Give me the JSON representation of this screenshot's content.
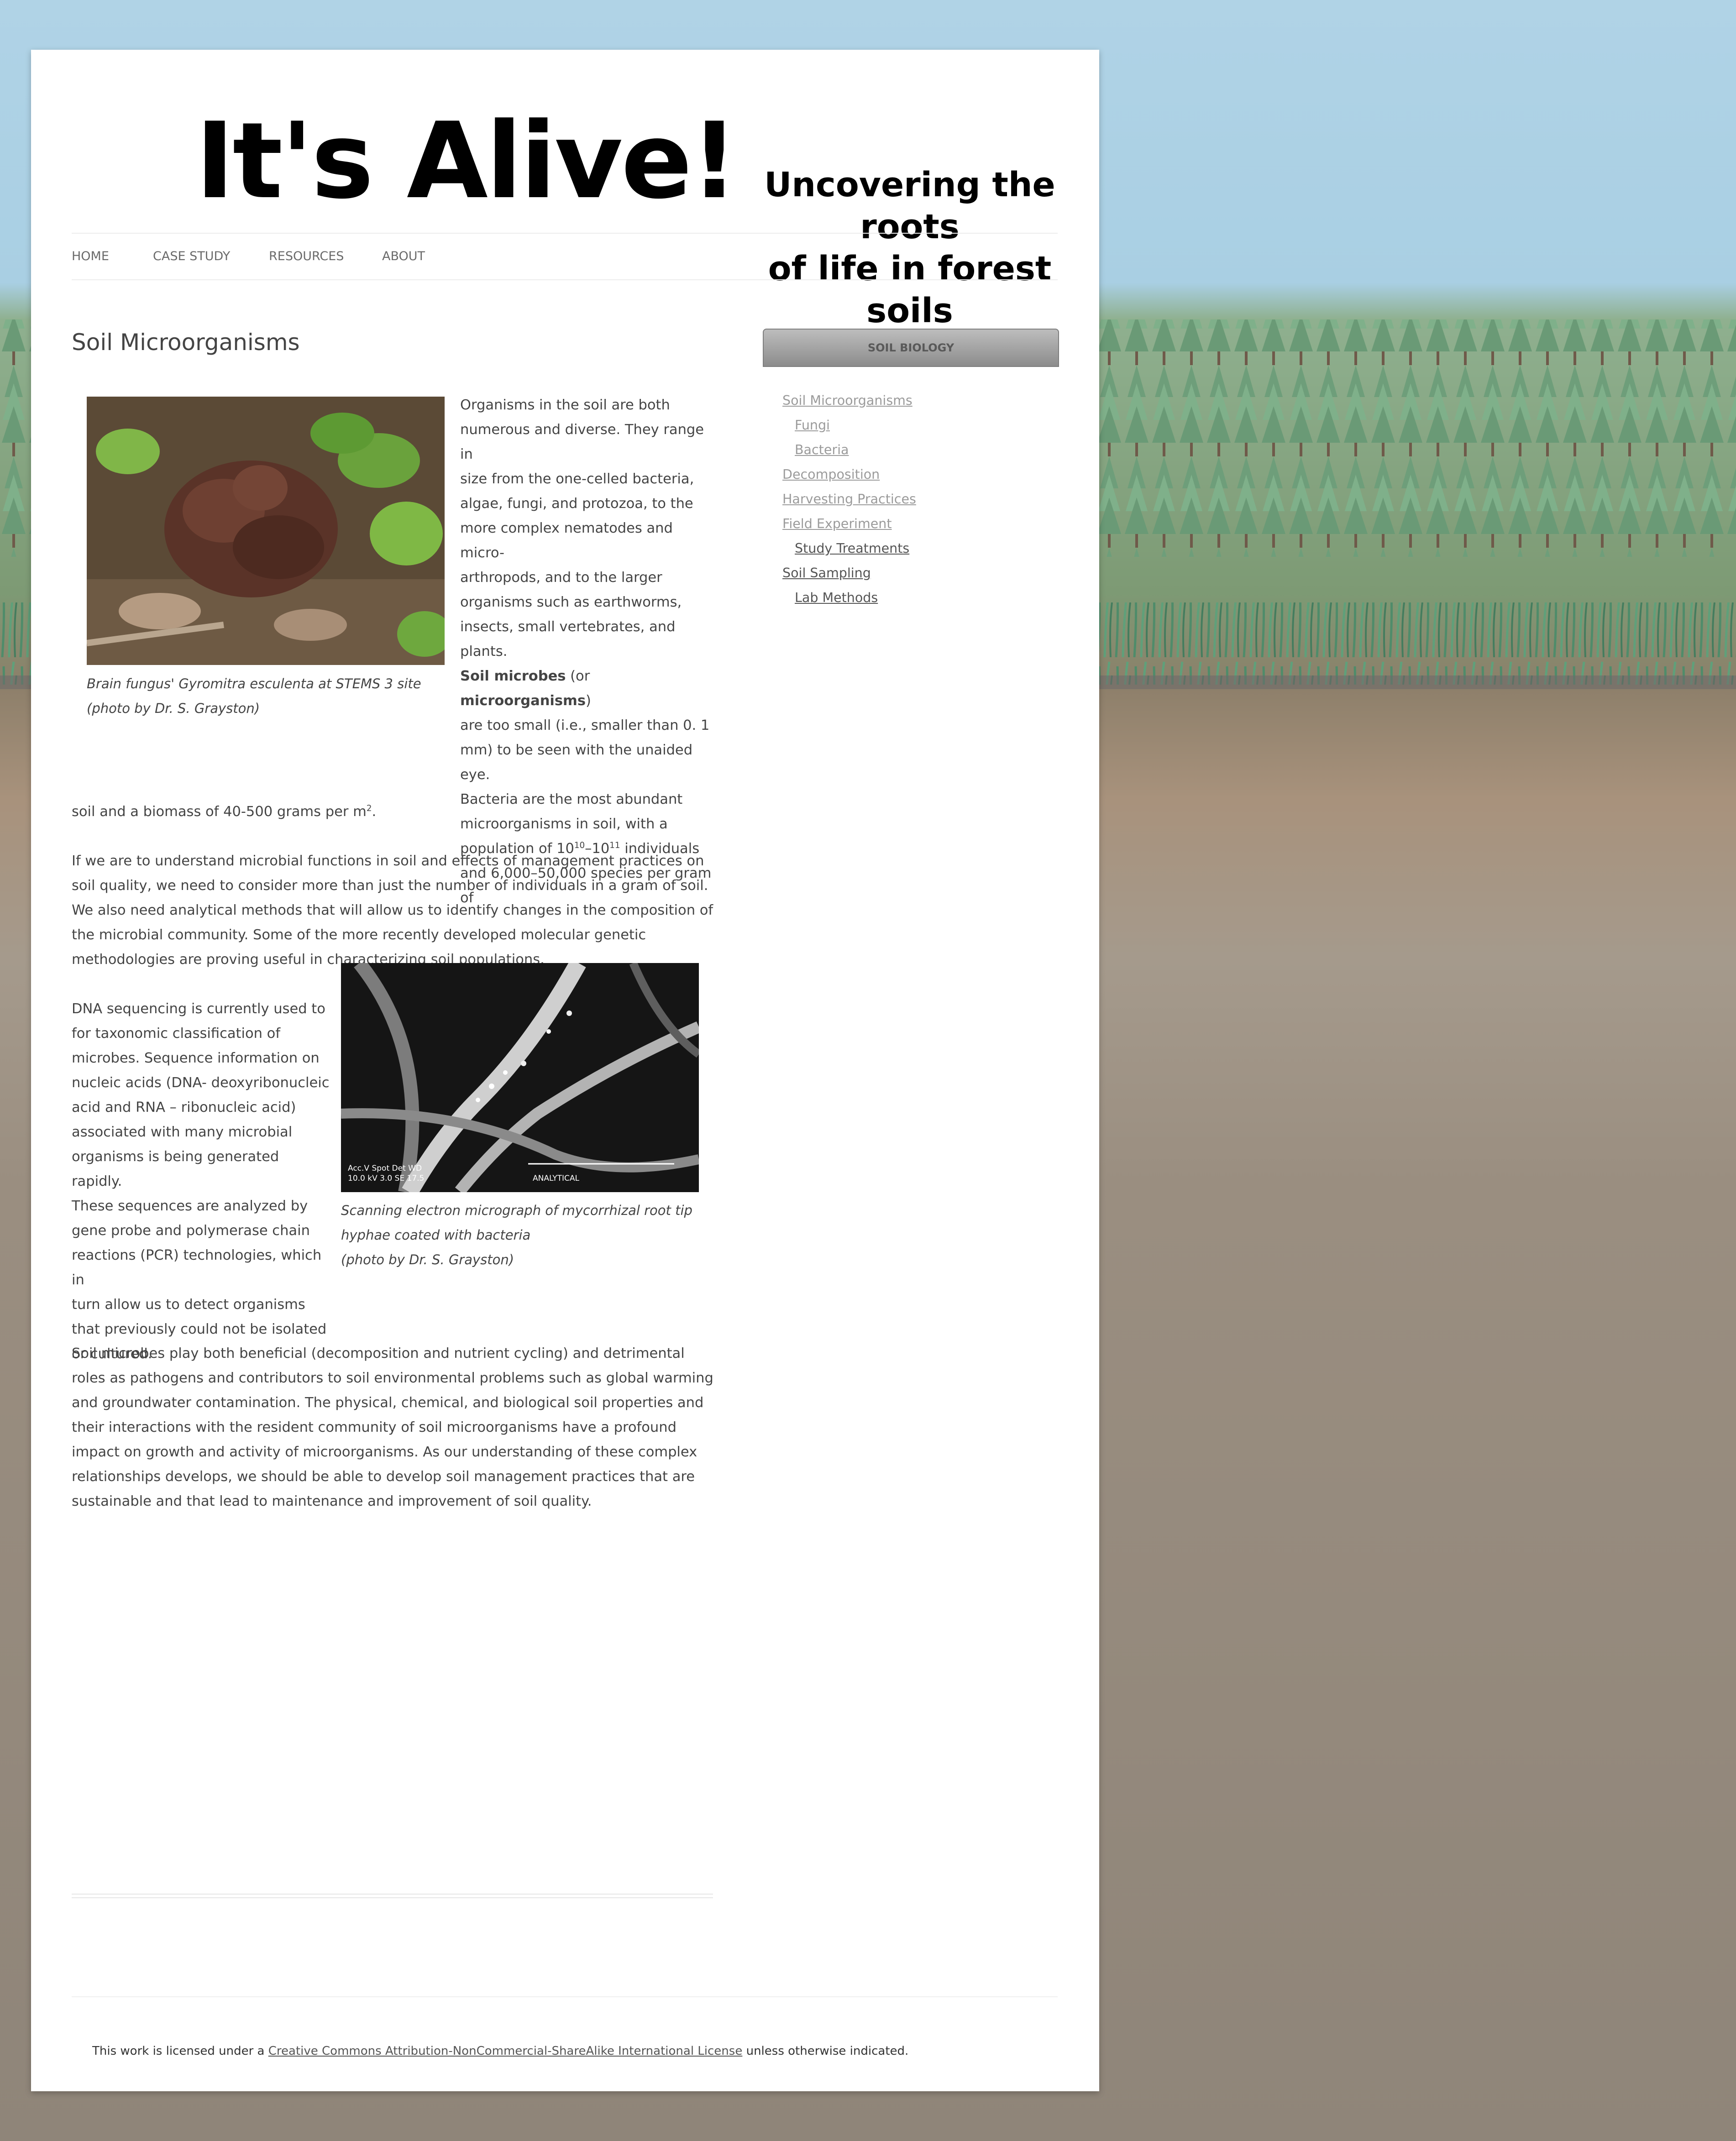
{
  "header": {
    "title": "It's Alive!",
    "subtitle_line1": "Uncovering the roots",
    "subtitle_line2": "of life in forest soils"
  },
  "nav": {
    "items": [
      "HOME",
      "CASE STUDY",
      "RESOURCES",
      "ABOUT"
    ]
  },
  "main": {
    "title": "Soil Microorganisms",
    "image1_caption_line1": "Brain fungus' Gyromitra esculenta at STEMS 3 site",
    "image1_caption_line2": "(photo by Dr. S. Grayston)",
    "para1_lines": [
      "Organisms in the soil are both",
      "numerous and diverse. They range in",
      "size from the one-celled bacteria,",
      "algae, fungi, and protozoa, to the",
      "more complex nematodes and micro-",
      "arthropods, and to the larger",
      "organisms such as earthworms,",
      "insects, small vertebrates, and plants."
    ],
    "para1_bold1": "Soil microbes",
    "para1_mid": " (or ",
    "para1_bold2": "microorganisms",
    "para1_after": ")",
    "para1_lines2": [
      "are too small (i.e., smaller than 0. 1",
      "mm) to be seen with the unaided eye.",
      "Bacteria are the most abundant",
      "microorganisms in soil, with a"
    ],
    "para1_pop_a": "population of 10",
    "para1_exp1": "10",
    "para1_pop_b": "–10",
    "para1_exp2": "11",
    "para1_pop_c": " individuals",
    "para1_line_species": "and 6,000–50,000 species per gram of",
    "para1_last_a": "soil and a biomass of 40-500 grams per m",
    "para1_last_exp": "2",
    "para1_last_b": ".",
    "para2": "If we are to understand microbial functions in soil and effects of management practices on soil quality, we need to consider more than just the number of individuals in a gram of soil. We also need analytical methods that will allow us to identify changes in the composition of the microbial community. Some of the more recently developed molecular genetic methodologies are proving useful in characterizing soil populations.",
    "para3_lines": [
      "DNA sequencing is currently  used to",
      "for taxonomic classification of",
      "microbes. Sequence information on",
      "nucleic acids (DNA- deoxyribonucleic",
      "acid and RNA – ribonucleic acid)",
      "associated with many microbial",
      "organisms is being generated rapidly.",
      "These sequences are analyzed by",
      "gene probe and polymerase chain",
      "reactions (PCR) technologies, which in",
      "turn allow us to detect organisms",
      "that previously could not be isolated",
      "or cultured."
    ],
    "image2_caption_line1": "Scanning electron micrograph of mycorrhizal root tip",
    "image2_caption_line2": "hyphae coated with bacteria",
    "image2_caption_line3": "(photo by Dr. S. Grayston)",
    "image2_overlay_text1": "Acc.V   Spot Det   WD",
    "image2_overlay_text2": "10.0 kV 3.0   SE   17.5",
    "image2_overlay_text3": "ANALYTICAL",
    "para4": "Soil microbes play both beneficial (decomposition and nutrient cycling) and detrimental roles as pathogens and contributors to soil environmental problems such as global warming and groundwater contamination. The physical, chemical, and biological soil properties and their interactions with the resident community of soil microorganisms have a profound impact on growth and activity of microorganisms. As our understanding of these complex relationships develops, we should be able to develop soil management practices that are sustainable and that lead to maintenance and improvement of soil quality."
  },
  "sidebar": {
    "header": "SOIL BIOLOGY",
    "links": [
      {
        "label": "Soil Microorganisms",
        "level": 0,
        "style": "visited"
      },
      {
        "label": "Fungi",
        "level": 1,
        "style": "visited"
      },
      {
        "label": "Bacteria",
        "level": 1,
        "style": "visited"
      },
      {
        "label": "Decomposition",
        "level": 0,
        "style": "visited"
      },
      {
        "label": "Harvesting Practices",
        "level": 0,
        "style": "visited"
      },
      {
        "label": "Field Experiment",
        "level": 0,
        "style": "visited"
      },
      {
        "label": "Study Treatments",
        "level": 1,
        "style": "link"
      },
      {
        "label": "Soil Sampling",
        "level": 0,
        "style": "link"
      },
      {
        "label": "Lab Methods",
        "level": 1,
        "style": "link"
      }
    ]
  },
  "footer": {
    "prefix": "This work is licensed under a ",
    "link": "Creative Commons Attribution-NonCommercial-ShareAlike International License",
    "suffix": " unless otherwise indicated."
  },
  "colors": {
    "sky": "#b0d3e6",
    "soil": "#8f8579",
    "text": "#444444",
    "link_visited": "#9b9b9b"
  }
}
